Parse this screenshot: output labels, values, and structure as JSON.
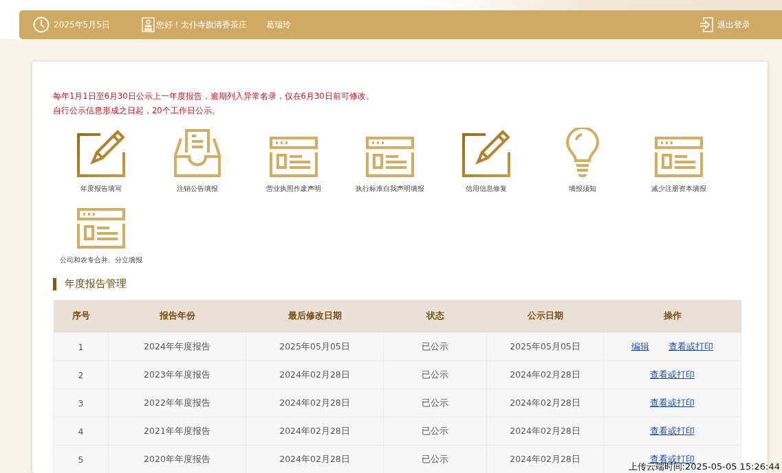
{
  "header": {
    "date": "2025年5月5日",
    "greeting": "您好！太仆寺旗清香茶庄",
    "user": "葛瑞玲",
    "logout": "退出登录"
  },
  "notices": [
    "每年1月1日至6月30日公示上一年度报告，逾期列入异常名录，仅在6月30日前可修改。",
    "自行公示信息形成之日起，20个工作日公示。"
  ],
  "services": [
    {
      "kind": "edit",
      "label": "年度报告填写"
    },
    {
      "kind": "inbox",
      "label": "注销公告填报"
    },
    {
      "kind": "panel",
      "label": "营业执照作废声明"
    },
    {
      "kind": "panel",
      "label": "执行标准自我声明填报"
    },
    {
      "kind": "edit",
      "label": "信用信息修复"
    },
    {
      "kind": "bulb",
      "label": "填报须知"
    },
    {
      "kind": "panel",
      "label": "减少注册资本填报"
    },
    {
      "kind": "panel",
      "label": "公司和农专合并、分立填报"
    }
  ],
  "section_title": "年度报告管理",
  "table": {
    "columns": [
      "序号",
      "报告年份",
      "最后修改日期",
      "状态",
      "公示日期",
      "操作"
    ],
    "rows": [
      {
        "cells": [
          "1",
          "2024年年度报告",
          "2025年05月05日",
          "已公示",
          "2025年05月05日"
        ],
        "actions": [
          "编辑",
          "查看或打印"
        ]
      },
      {
        "cells": [
          "2",
          "2023年年度报告",
          "2024年02月28日",
          "已公示",
          "2024年02月28日"
        ],
        "actions": [
          "查看或打印"
        ]
      },
      {
        "cells": [
          "3",
          "2022年年度报告",
          "2024年02月28日",
          "已公示",
          "2024年02月28日"
        ],
        "actions": [
          "查看或打印"
        ]
      },
      {
        "cells": [
          "4",
          "2021年年度报告",
          "2024年02月28日",
          "已公示",
          "2024年02月28日"
        ],
        "actions": [
          "查看或打印"
        ]
      },
      {
        "cells": [
          "5",
          "2020年年度报告",
          "2024年02月28日",
          "已公示",
          "2024年02月28日"
        ],
        "actions": [
          "查看或打印"
        ]
      }
    ]
  },
  "upload_time": "上传云端时间:2025-05-05 15:26:44"
}
